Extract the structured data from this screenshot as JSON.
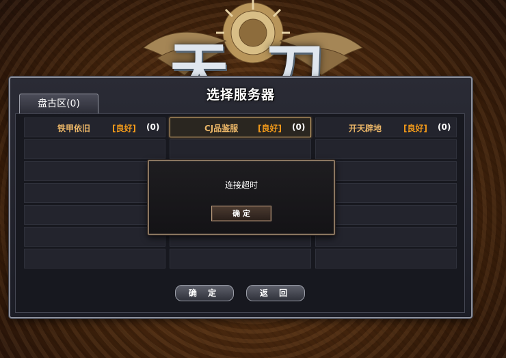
{
  "game": {
    "logo_text": "天 刀"
  },
  "server_select": {
    "title": "选择服务器",
    "tab_label": "盘古区(0)",
    "servers": [
      {
        "name": "铁甲依旧",
        "status": "[良好]",
        "count": "(0)",
        "selected": false
      },
      {
        "name": "CJ品鉴服",
        "status": "[良好]",
        "count": "(0)",
        "selected": true
      },
      {
        "name": "开天辟地",
        "status": "[良好]",
        "count": "(0)",
        "selected": false
      }
    ],
    "confirm_label": "确 定",
    "back_label": "返 回"
  },
  "dialog": {
    "message": "连接超时",
    "ok_label": "确 定"
  },
  "colors": {
    "server_name": "#e9b567",
    "status_good": "#f29a1a",
    "selected_border": "#c9a46a"
  }
}
